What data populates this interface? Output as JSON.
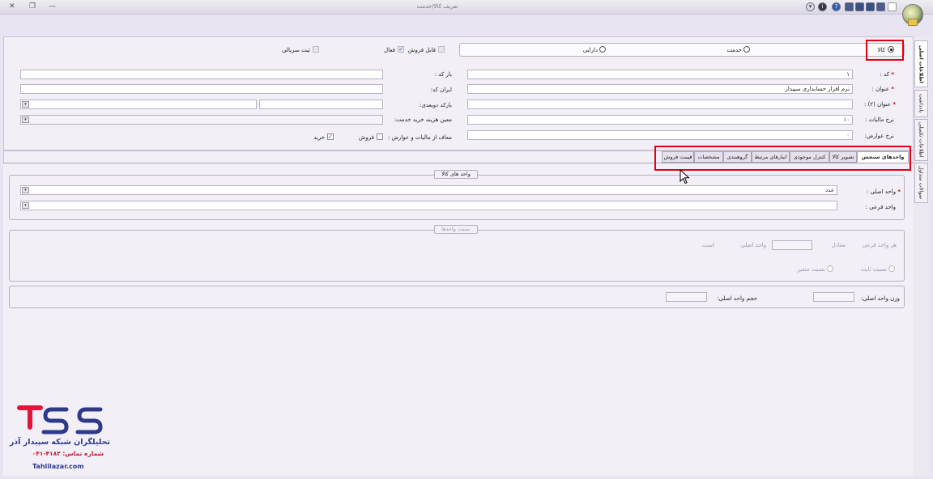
{
  "window": {
    "title": "تعریف کالا/خدمت",
    "close_glyph": "✕",
    "restore_glyph": "❐",
    "minimize_glyph": "—"
  },
  "toolbar": {
    "icons": [
      "new-doc-icon",
      "save-icon",
      "save-as-icon",
      "save-all-icon",
      "print-icon",
      "help-icon",
      "info-icon",
      "dropdown-icon"
    ],
    "help_glyph": "?",
    "info_glyph": "i",
    "dropdown_glyph": "▾"
  },
  "side_tabs": [
    "اطلاعات اصلی",
    "یادداشت",
    "اطلاعات تکمیلی",
    "سوالات متداول"
  ],
  "type_group": {
    "kala": "کالا",
    "khedmat": "خدمت",
    "daraei": "دارایی",
    "selected": "کالا"
  },
  "options": {
    "qabel_forush": "قابل فروش",
    "faal": "فعال",
    "sabt_seriali": "ثبت سریالی",
    "forush": "فروش",
    "kharid": "خرید",
    "moaf_label": "معاف از مالیات و عوارض :",
    "check": "✓"
  },
  "fields": {
    "code_label": "کد :",
    "code_value": "۱",
    "onvan_label": "عنوان :",
    "onvan_value": "نرم افزار حسابداری سپیدار",
    "onvan2_label": "عنوان (۲) :",
    "nerkh_maliat_label": "نرخ مالیات :",
    "nerkh_maliat_value": "۱۰",
    "nerkh_avarez_label": "نرخ عوارض:",
    "nerkh_avarez_value": "۰",
    "barcode_label": "بار کد :",
    "irancode_label": "ایران کد:",
    "barcode2_label": "بارکد دوبعدی:",
    "moein_label": "معین هزینه خرید خدمت:",
    "required_mark": "*",
    "combo_glyph": "▾"
  },
  "tabs": [
    {
      "label": "واحدهای سنجش",
      "active": true
    },
    {
      "label": "تصویر کالا",
      "active": false
    },
    {
      "label": "کنترل موجودی",
      "active": false
    },
    {
      "label": "انبارهای مرتبط",
      "active": false
    },
    {
      "label": "گروهبندی",
      "active": false
    },
    {
      "label": "مشخصات",
      "active": false
    },
    {
      "label": "قیمت فروش",
      "active": false
    }
  ],
  "units_group": {
    "title": "واحد های کالا",
    "main_unit_label": "واحد اصلی :",
    "main_unit_value": "عدد",
    "sub_unit_label": "واحد فرعی :"
  },
  "ratio_group": {
    "title": "نسبت واحدها",
    "har_vahed_farei": "هر واحد فرعی",
    "moadel": "معادل",
    "vahed_asli": "واحد اصلی",
    "ast": "است.",
    "nesbat_sabet": "نسبت ثابت",
    "nesbat_motaghayer": "نسبت متغیر"
  },
  "weight_group": {
    "vazn_label": "وزن واحد اصلی:",
    "hajm_label": "حجم واحد اصلی:"
  },
  "watermark": {
    "brand_title": "تحلیلگران شبکه سپیدار آذر",
    "phone_line": "شماره تماس: ۴۱۸۲-۰۴۱",
    "website": "Tahlilazar.com"
  }
}
